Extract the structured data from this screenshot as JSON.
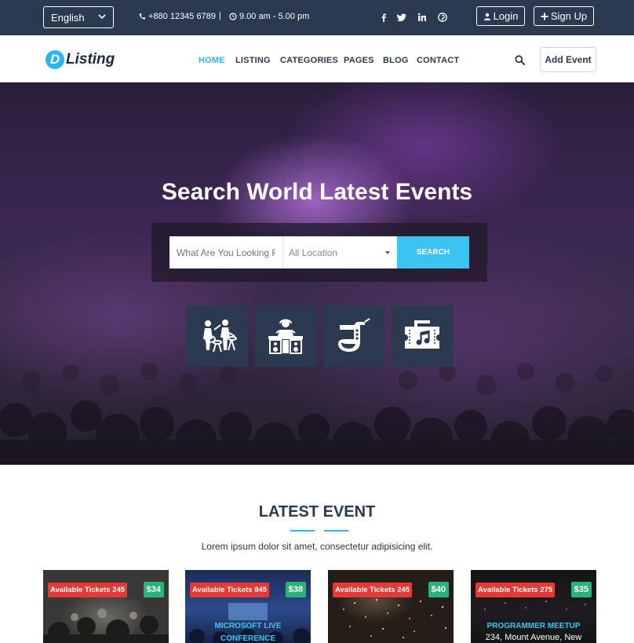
{
  "topbar": {
    "language": "English",
    "phone": "+880 12345 6789",
    "separator": "|",
    "hours": "9.00 am - 5.00 pm",
    "social_icons": [
      "facebook-icon",
      "twitter-icon",
      "linkedin-icon",
      "pinterest-icon"
    ],
    "login_label": "Login",
    "signup_label": "Sign Up"
  },
  "nav": {
    "logo_letter": "D",
    "logo_text": "Listing",
    "items": [
      "HOME",
      "LISTING",
      "CATEGORIES",
      "PAGES",
      "BLOG",
      "CONTACT"
    ],
    "active_item": "HOME",
    "add_event_label": "Add Event"
  },
  "hero": {
    "title": "Search World Latest Events",
    "search_placeholder": "What Are You Looking For?",
    "location_value": "All Location",
    "search_button": "SEARCH",
    "categories": [
      "band-icon",
      "dj-icon",
      "saxophone-icon",
      "ticket-icon"
    ]
  },
  "latest": {
    "title": "LATEST EVENT",
    "subtitle": "Lorem ipsum dolor sit amet, consectetur adipisicing elit.",
    "cards": [
      {
        "badge": "Available Tickets 245",
        "price": "$34",
        "title": "",
        "line": ""
      },
      {
        "badge": "Available Tickets 845",
        "price": "$38",
        "title": "MICROSOFT LIVE",
        "title2": "CONFERENCE"
      },
      {
        "badge": "Available Tickets 245",
        "price": "$40",
        "title": "",
        "line": ""
      },
      {
        "badge": "Available Tickets 275",
        "price": "$35",
        "title": "PROGRAMMER MEETUP",
        "line": "234, Mount Avenue, New"
      }
    ]
  },
  "colors": {
    "topbar": "#2b3a4e",
    "accent": "#29b6f6",
    "badge_red": "#e53935",
    "price_green": "#26b47a"
  }
}
